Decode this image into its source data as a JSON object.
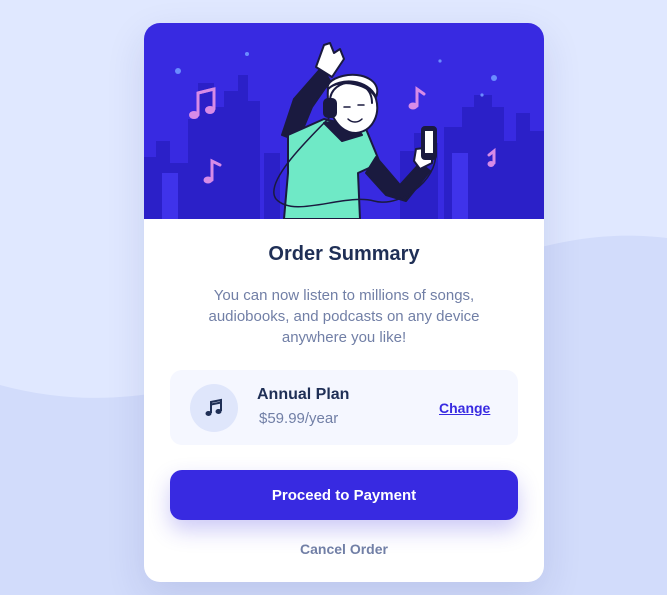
{
  "colors": {
    "page_background": "#e0e8ff",
    "wave": "#d2dcfb",
    "card_background": "#ffffff",
    "hero_background": "#382ae1",
    "primary": "#382ae1",
    "heading": "#1f2f56",
    "muted_text": "#717fa6",
    "plan_box": "#f5f7ff",
    "note_pink": "#d78be7",
    "character_teal": "#6fe9c6"
  },
  "hero": {
    "illustration": "dancing-person-with-headphones"
  },
  "order": {
    "title": "Order Summary",
    "description": "You can now listen to millions of songs, audiobooks, and podcasts on any device anywhere you like!"
  },
  "plan": {
    "icon": "music-note-icon",
    "name": "Annual Plan",
    "price": "$59.99/year",
    "change_label": "Change"
  },
  "actions": {
    "proceed_label": "Proceed to Payment",
    "cancel_label": "Cancel Order"
  }
}
